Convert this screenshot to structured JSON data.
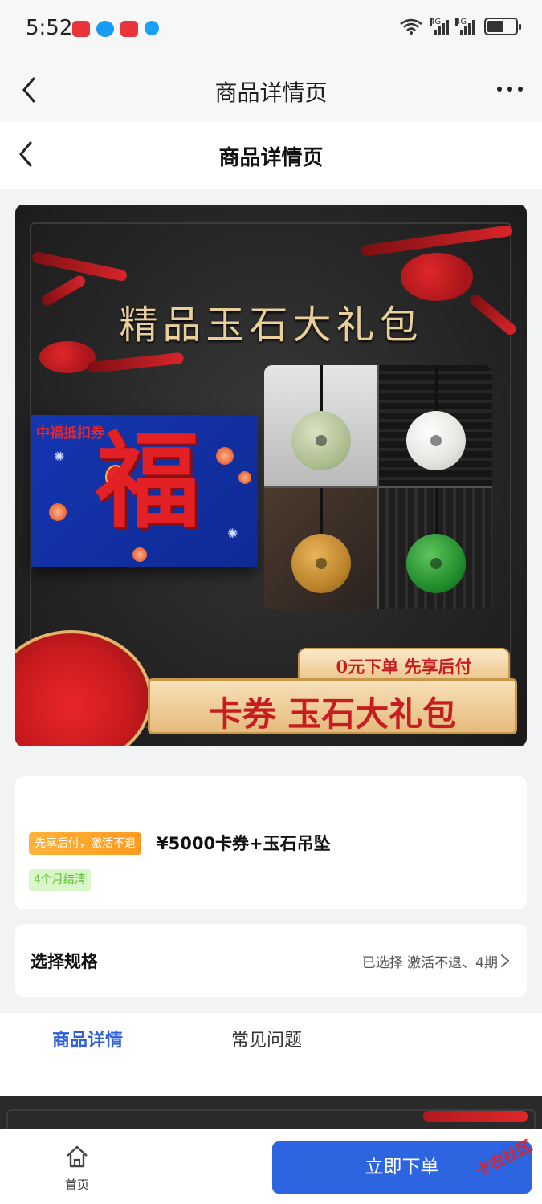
{
  "status_bar": {
    "time": "5:52",
    "network_label_1": "4G",
    "network_label_2": "4G"
  },
  "top_nav": {
    "title": "商品详情页"
  },
  "page_header": {
    "title": "商品详情页"
  },
  "banner": {
    "headline": "精品玉石大礼包",
    "coupon_label": "中福抵扣券",
    "fu_character": "福",
    "tag_text": "0元下单 先享后付",
    "product_text": "卡券 玉石大礼包"
  },
  "product_info": {
    "badge": "先享后付，激活不退",
    "title": "¥5000卡券+玉石吊坠",
    "term_badge": "4个月结清"
  },
  "spec": {
    "label": "选择规格",
    "selected": "已选择 激活不退、4期"
  },
  "tabs": [
    {
      "label": "商品详情",
      "active": true
    },
    {
      "label": "常见问题",
      "active": false
    }
  ],
  "bottom_bar": {
    "home_label": "首页",
    "order_button": "立即下单",
    "watermark": "卡农社区"
  },
  "colors": {
    "accent_blue": "#2d64e0",
    "tab_active": "#2f5fd8",
    "badge_orange": "#ff9a1f",
    "badge_green_bg": "#d9f7c9",
    "badge_green_text": "#5dbb2f"
  }
}
